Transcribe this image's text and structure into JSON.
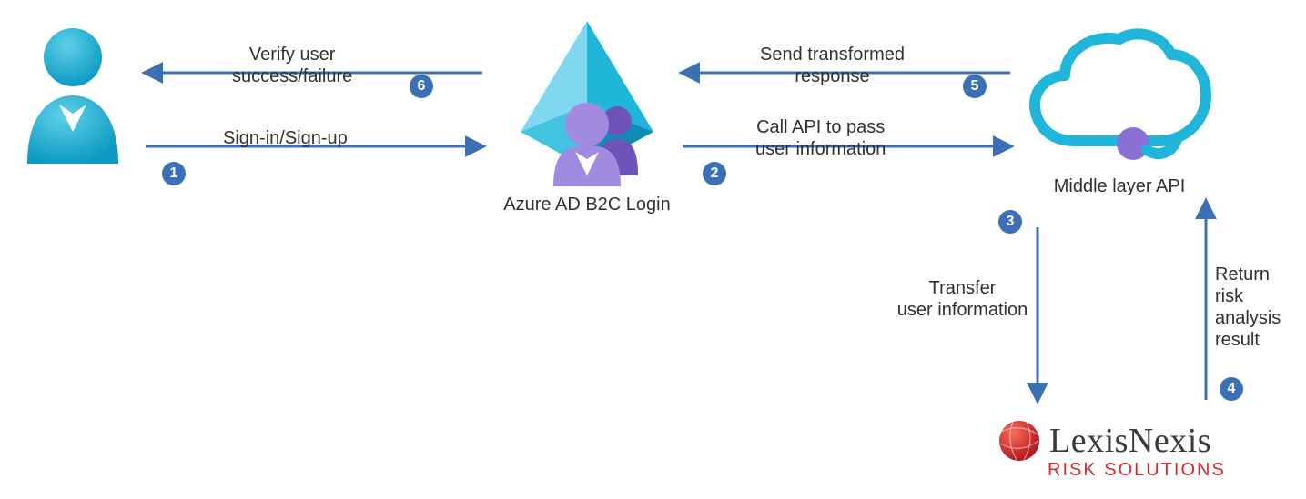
{
  "nodes": {
    "user": {
      "label": ""
    },
    "azure": {
      "label": "Azure AD B2C Login"
    },
    "middle": {
      "label": "Middle layer API"
    },
    "lexis": {
      "name": "LexisNexis",
      "subtitle": "RISK SOLUTIONS"
    }
  },
  "steps": {
    "s1": {
      "num": "1",
      "label": "Sign-in/Sign-up"
    },
    "s2": {
      "num": "2",
      "label_line1": "Call API to pass",
      "label_line2": "user information"
    },
    "s3": {
      "num": "3",
      "label_line1": "Transfer",
      "label_line2": "user information"
    },
    "s4": {
      "num": "4",
      "label_line1": "Return",
      "label_line2": "risk analysis",
      "label_line3": "result"
    },
    "s5": {
      "num": "5",
      "label_line1": "Send transformed",
      "label_line2": "response"
    },
    "s6": {
      "num": "6",
      "label_line1": "Verify user",
      "label_line2": "success/failure"
    }
  },
  "colors": {
    "arrow": "#3b6fb6",
    "badge": "#3b6fb6",
    "userFill": "#1fb6d9",
    "azurePyramidLight": "#7fd8f0",
    "azurePyramidMid": "#1fb6d9",
    "azurePyramidDark": "#0f8cb5",
    "purple": "#8a6fd4",
    "purpleDark": "#6d54b8",
    "cloudStroke": "#1fb6d9",
    "lexisRed": "#d9272e"
  }
}
